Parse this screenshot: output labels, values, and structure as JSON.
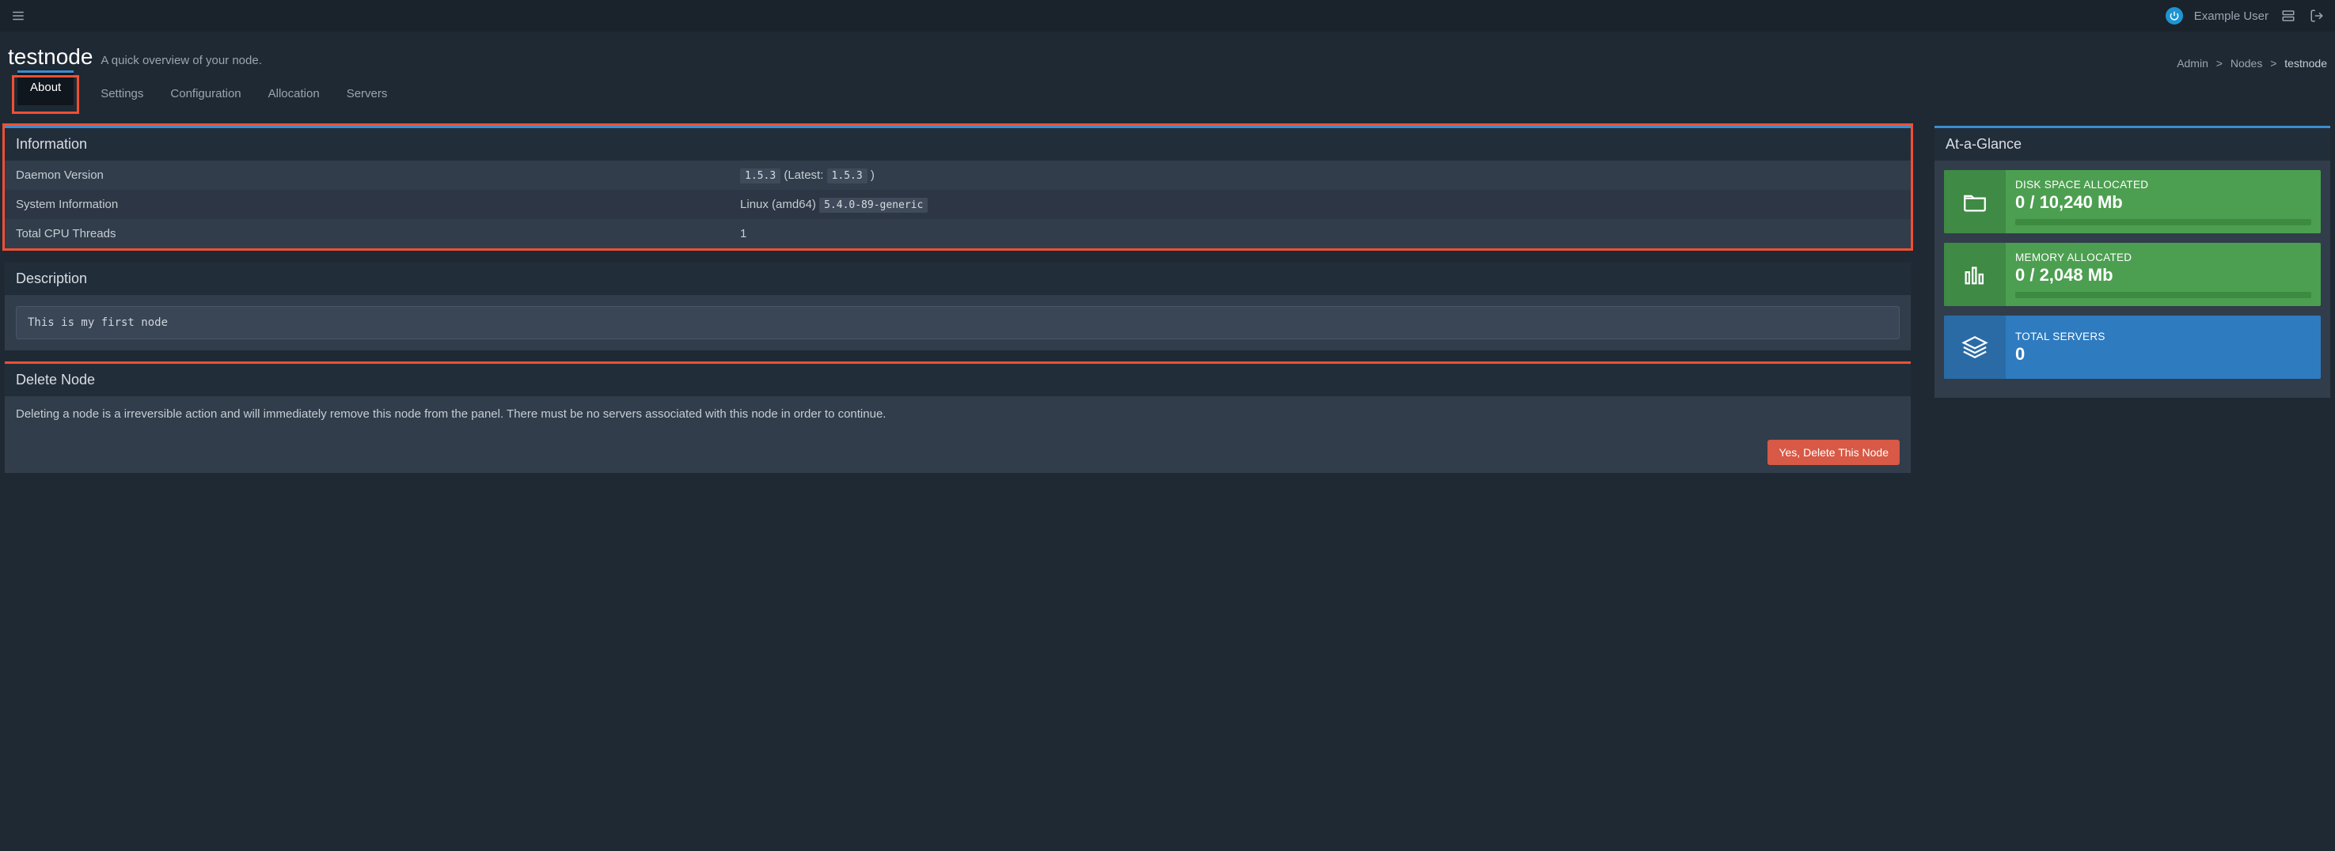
{
  "navbar": {
    "user_name": "Example User"
  },
  "header": {
    "title": "testnode",
    "subtitle": "A quick overview of your node."
  },
  "breadcrumb": {
    "items": [
      "Admin",
      "Nodes",
      "testnode"
    ]
  },
  "tabs": {
    "items": [
      {
        "id": "about",
        "label": "About",
        "active": true
      },
      {
        "id": "settings",
        "label": "Settings",
        "active": false
      },
      {
        "id": "configuration",
        "label": "Configuration",
        "active": false
      },
      {
        "id": "allocation",
        "label": "Allocation",
        "active": false
      },
      {
        "id": "servers",
        "label": "Servers",
        "active": false
      }
    ]
  },
  "info": {
    "heading": "Information",
    "rows": {
      "daemon_version": {
        "label": "Daemon Version",
        "current": "1.5.3",
        "latest_prefix": "(Latest:",
        "latest": "1.5.3",
        "latest_suffix": ")"
      },
      "system_info": {
        "label": "System Information",
        "os": "Linux (amd64)",
        "kernel": "5.4.0-89-generic"
      },
      "cpu_threads": {
        "label": "Total CPU Threads",
        "value": "1"
      }
    }
  },
  "description": {
    "heading": "Description",
    "text": "This is my first node"
  },
  "delete": {
    "heading": "Delete Node",
    "body": "Deleting a node is a irreversible action and will immediately remove this node from the panel. There must be no servers associated with this node in order to continue.",
    "button": "Yes, Delete This Node"
  },
  "glance": {
    "heading": "At-a-Glance",
    "cards": {
      "disk": {
        "label": "DISK SPACE ALLOCATED",
        "value": "0 / 10,240 Mb"
      },
      "memory": {
        "label": "MEMORY ALLOCATED",
        "value": "0 / 2,048 Mb"
      },
      "servers": {
        "label": "TOTAL SERVERS",
        "value": "0"
      }
    }
  }
}
